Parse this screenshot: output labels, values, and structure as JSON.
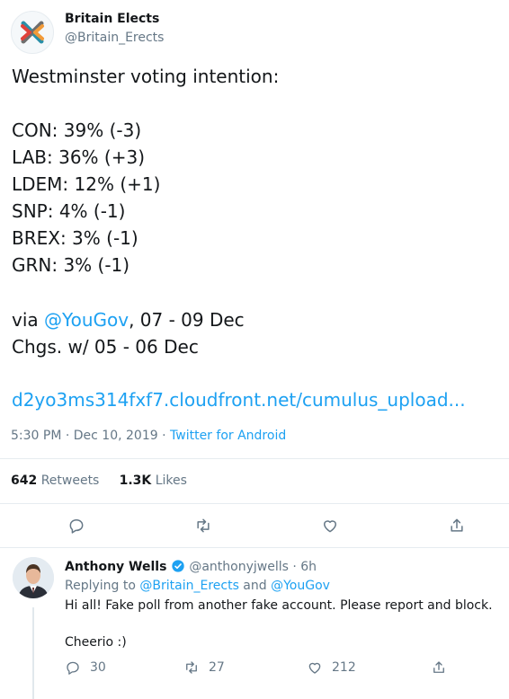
{
  "tweet": {
    "author_name": "Britain Elects",
    "author_handle": "@Britain_Erects",
    "heading": "Westminster voting intention:",
    "results": [
      "CON: 39% (-3)",
      "LAB: 36% (+3)",
      "LDEM: 12% (+1)",
      "SNP: 4% (-1)",
      "BREX: 3% (-1)",
      "GRN: 3% (-1)"
    ],
    "via_prefix": "via ",
    "via_mention": "@YouGov",
    "via_suffix": ", 07 - 09 Dec",
    "changes": "Chgs. w/ 05 - 06 Dec",
    "link": "d2yo3ms314fxf7.cloudfront.net/cumulus_upload...",
    "timestamp": "5:30 PM · Dec 10, 2019",
    "separator": " · ",
    "source": "Twitter for Android",
    "retweets_count": "642",
    "retweets_label": "Retweets",
    "likes_count": "1.3K",
    "likes_label": "Likes"
  },
  "reply": {
    "author_name": "Anthony Wells",
    "author_handle": "@anthonyjwells",
    "age": " · 6h",
    "replying_prefix": "Replying to ",
    "replying_user1": "@Britain_Erects",
    "replying_and": " and ",
    "replying_user2": "@YouGov",
    "line1": "Hi all! Fake poll from another fake account. Please report and block.",
    "line2": "Cheerio :)",
    "replies_count": "30",
    "retweets_count": "27",
    "likes_count": "212"
  },
  "colors": {
    "accent": "#1da1f2",
    "muted": "#657786",
    "logo_red": "#e0413a",
    "logo_orange": "#f29a38",
    "logo_teal": "#2a8fa8",
    "logo_gray": "#6e6e6e"
  }
}
